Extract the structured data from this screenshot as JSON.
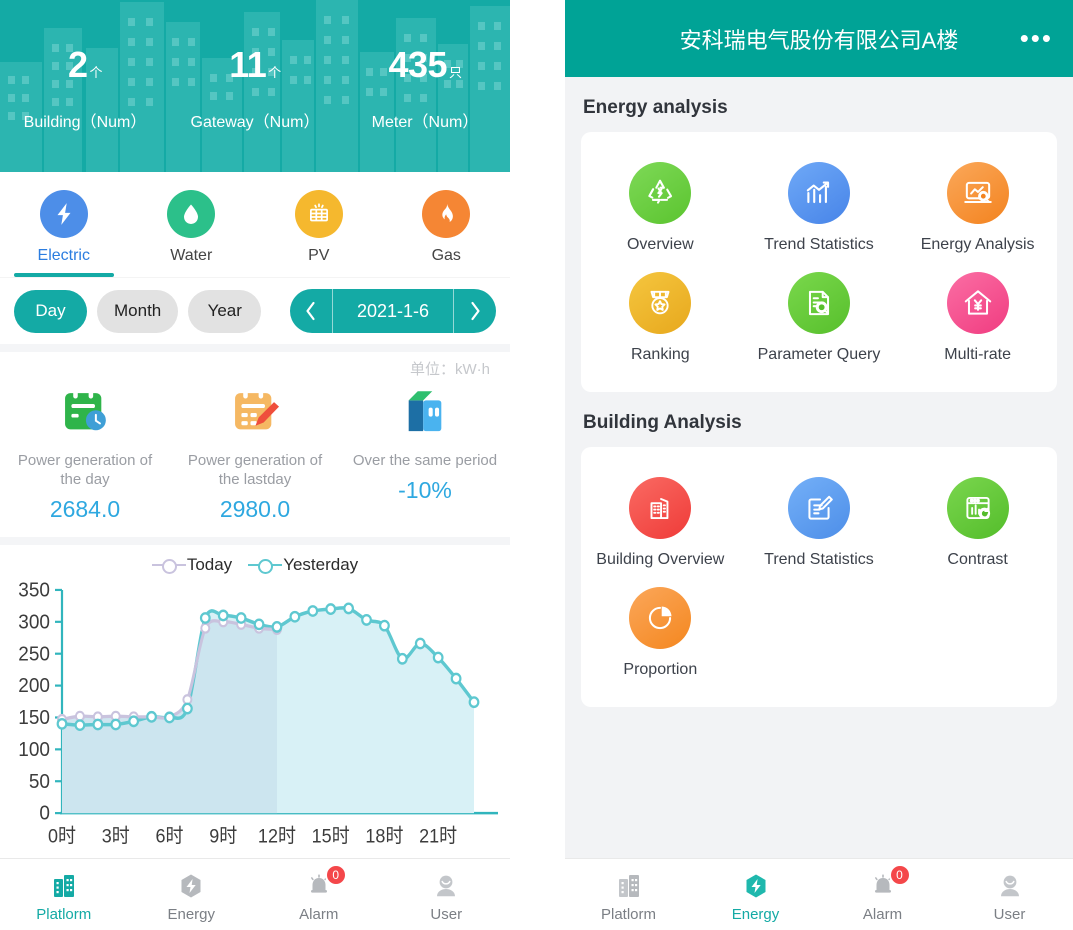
{
  "left": {
    "hero": {
      "items": [
        {
          "value": "2",
          "unit": "个",
          "label": "Building（Num）"
        },
        {
          "value": "11",
          "unit": "个",
          "label": "Gateway（Num）"
        },
        {
          "value": "435",
          "unit": "只",
          "label": "Meter（Num）"
        }
      ]
    },
    "energy_tabs": [
      {
        "label": "Electric",
        "icon": "lightning-bolt-icon",
        "color": "#4d8ee8",
        "active": true
      },
      {
        "label": "Water",
        "icon": "water-drop-icon",
        "color": "#2cc08a",
        "active": false
      },
      {
        "label": "PV",
        "icon": "solar-panel-icon",
        "color": "#f5b82e",
        "active": false
      },
      {
        "label": "Gas",
        "icon": "flame-icon",
        "color": "#f58634",
        "active": false
      }
    ],
    "period": {
      "chips": [
        {
          "label": "Day",
          "active": true
        },
        {
          "label": "Month",
          "active": false
        },
        {
          "label": "Year",
          "active": false
        }
      ],
      "prev_icon": "chevron-left-icon",
      "next_icon": "chevron-right-icon",
      "date": "2021-1-6"
    },
    "stats": {
      "unit_note": "单位：kW·h",
      "items": [
        {
          "title": "Power generation of the day",
          "value": "2684.0",
          "icon": "calendar-clock-icon"
        },
        {
          "title": "Power generation of the lastday",
          "value": "2980.0",
          "icon": "calendar-edit-icon"
        },
        {
          "title": "Over the same period",
          "value": "-10%",
          "icon": "book-compare-icon"
        }
      ]
    },
    "bottom_nav": [
      {
        "label": "Platlorm",
        "icon": "building-icon",
        "active": true,
        "badge": null
      },
      {
        "label": "Energy",
        "icon": "energy-bolt-icon",
        "active": false,
        "badge": null
      },
      {
        "label": "Alarm",
        "icon": "alarm-bell-icon",
        "active": false,
        "badge": "0"
      },
      {
        "label": "User",
        "icon": "user-icon",
        "active": false,
        "badge": null
      }
    ]
  },
  "right": {
    "header": {
      "title": "安科瑞电气股份有限公司A楼",
      "menu_icon": "more-dots-icon"
    },
    "sections": [
      {
        "title": "Energy analysis",
        "items": [
          {
            "label": "Overview",
            "icon": "recycle-energy-icon",
            "color": "#61c634",
            "color2": "#7ed957"
          },
          {
            "label": "Trend Statistics",
            "icon": "bar-chart-trend-icon",
            "color": "#4f92ef",
            "color2": "#6ba9f7"
          },
          {
            "label": "Energy Analysis",
            "icon": "monitor-search-icon",
            "color": "#f6922f",
            "color2": "#fba košice"
          },
          {
            "label": "Ranking",
            "icon": "medal-icon",
            "color": "#f0b92b",
            "color2": "#f5c63f"
          },
          {
            "label": "Parameter Query",
            "icon": "document-search-icon",
            "color": "#63c537",
            "color2": "#7ad84c"
          },
          {
            "label": "Multi-rate",
            "icon": "house-yen-icon",
            "color": "#f4538f",
            "color2": "#fb6ea4"
          }
        ]
      },
      {
        "title": "Building Analysis",
        "items": [
          {
            "label": "Building Overview",
            "icon": "buildings-icon",
            "color": "#f4514e",
            "color2": "#fa6a63"
          },
          {
            "label": "Trend Statistics",
            "icon": "document-edit-icon",
            "color": "#5b9cf0",
            "color2": "#74b0f8"
          },
          {
            "label": "Contrast",
            "icon": "chart-refresh-icon",
            "color": "#5fc238",
            "color2": "#7ad64e"
          },
          {
            "label": "Proportion",
            "icon": "pie-chart-icon",
            "color": "#f79338",
            "color2": "#fba75a"
          }
        ]
      }
    ],
    "bottom_nav": [
      {
        "label": "Platlorm",
        "icon": "building-icon",
        "active": false,
        "badge": null
      },
      {
        "label": "Energy",
        "icon": "energy-bolt-icon",
        "active": true,
        "badge": null
      },
      {
        "label": "Alarm",
        "icon": "alarm-bell-icon",
        "active": false,
        "badge": "0"
      },
      {
        "label": "User",
        "icon": "user-icon",
        "active": false,
        "badge": null
      }
    ]
  },
  "chart_data": {
    "type": "area",
    "title": "",
    "xlabel": "",
    "ylabel": "",
    "ylim": [
      0,
      350
    ],
    "yticks": [
      0,
      50,
      100,
      150,
      200,
      250,
      300,
      350
    ],
    "grid": false,
    "legend_position": "top-center",
    "x": [
      0,
      1,
      2,
      3,
      4,
      5,
      6,
      7,
      8,
      9,
      10,
      11,
      12,
      13,
      14,
      15,
      16,
      17,
      18,
      19,
      20,
      21,
      22,
      23
    ],
    "xtick_labels": [
      "0时",
      "3时",
      "6时",
      "9时",
      "12时",
      "15时",
      "18时",
      "21时"
    ],
    "xtick_values": [
      0,
      3,
      6,
      9,
      12,
      15,
      18,
      21
    ],
    "series": [
      {
        "name": "Today",
        "color": "#c9c3de",
        "values": [
          147,
          152,
          151,
          152,
          151,
          151,
          151,
          178,
          290,
          300,
          296,
          290,
          288,
          null,
          null,
          null,
          null,
          null,
          null,
          null,
          null,
          null,
          null,
          null
        ]
      },
      {
        "name": "Yesterday",
        "color": "#5ec8d0",
        "values": [
          140,
          138,
          139,
          139,
          144,
          151,
          150,
          164,
          306,
          310,
          306,
          296,
          292,
          308,
          317,
          320,
          321,
          303,
          294,
          242,
          266,
          244,
          211,
          174
        ]
      }
    ]
  }
}
